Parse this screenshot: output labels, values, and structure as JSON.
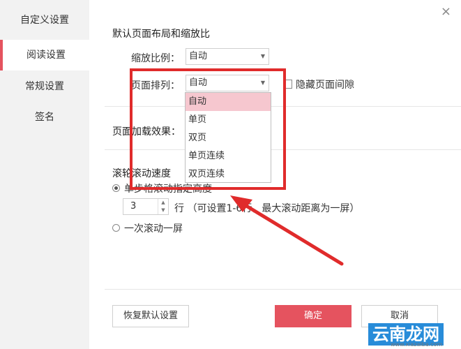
{
  "sidebar": {
    "title": "自定义设置",
    "items": [
      {
        "label": "阅读设置"
      },
      {
        "label": "常规设置"
      },
      {
        "label": "签名"
      }
    ]
  },
  "window": {
    "close_glyph": "×"
  },
  "layout_section": {
    "title": "默认页面布局和缩放比",
    "zoom_label": "缩放比例：",
    "zoom_value": "自动",
    "arrange_label": "页面排列：",
    "arrange_value": "自动",
    "hide_gap_label": "隐藏页面间隙",
    "dropdown_options": [
      "自动",
      "单页",
      "双页",
      "单页连续",
      "双页连续"
    ]
  },
  "load_section": {
    "title": "页面加载效果："
  },
  "scroll_section": {
    "title": "滚轮滚动速度",
    "option1": "单步格滚动指定高度",
    "lines_value": "3",
    "lines_note": "行 （可设置1-6行，最大滚动距离为一屏）",
    "option2": "一次滚动一屏"
  },
  "buttons": {
    "reset": "恢复默认设置",
    "ok": "确定",
    "cancel": "取消"
  },
  "watermark": {
    "text": "云南龙网",
    "url": "www.xiazaiba.com"
  },
  "colors": {
    "accent": "#e5535f",
    "highlight": "#e02b2b"
  }
}
